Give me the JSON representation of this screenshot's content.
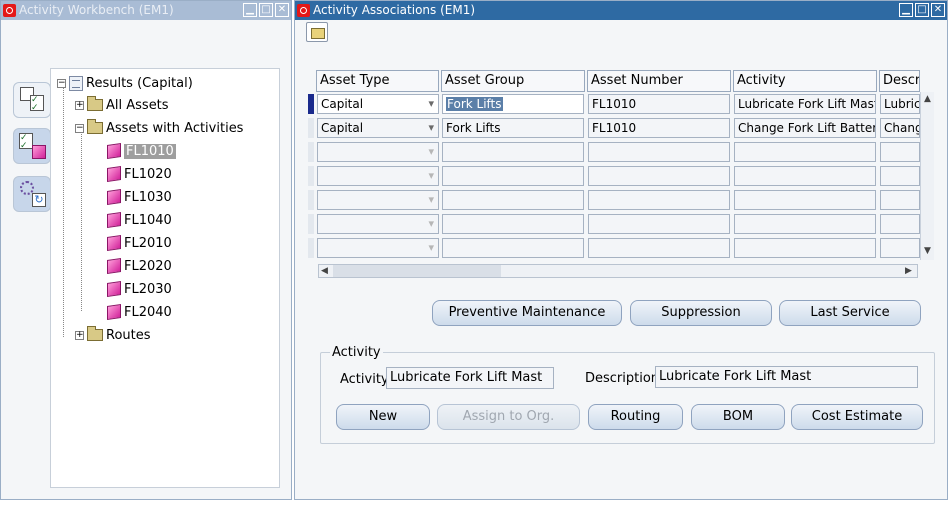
{
  "left_window": {
    "title": "Activity Workbench (EM1)",
    "tree": {
      "root": "Results (Capital)",
      "all_assets": "All Assets",
      "assets_with_activities": "Assets with Activities",
      "assets": [
        "FL1010",
        "FL1020",
        "FL1030",
        "FL1040",
        "FL2010",
        "FL2020",
        "FL2030",
        "FL2040"
      ],
      "routes": "Routes"
    },
    "side_icons": [
      "checklist-icon",
      "activity-icon",
      "refresh-icon"
    ]
  },
  "right_window": {
    "title": "Activity Associations (EM1)",
    "grid": {
      "headers": [
        "Asset Type",
        "Asset Group",
        "Asset Number",
        "Activity",
        "Descri"
      ],
      "rows": [
        {
          "asset_type": "Capital",
          "asset_group": "Fork Lifts",
          "asset_number": "FL1010",
          "activity": "Lubricate Fork Lift Mast",
          "description": "Lubric"
        },
        {
          "asset_type": "Capital",
          "asset_group": "Fork Lifts",
          "asset_number": "FL1010",
          "activity": "Change Fork Lift Battery",
          "description": "Chang"
        }
      ]
    },
    "action_buttons": {
      "preventive_maintenance": "Preventive Maintenance",
      "suppression": "Suppression",
      "last_service": "Last Service"
    },
    "activity_group": {
      "label": "Activity",
      "activity_label": "Activity",
      "activity_value": "Lubricate Fork Lift Mast",
      "description_label": "Description",
      "description_value": "Lubricate Fork Lift Mast"
    },
    "bottom_buttons": {
      "new": "New",
      "assign_to_org": "Assign to Org.",
      "routing": "Routing",
      "bom": "BOM",
      "cost_estimate": "Cost Estimate"
    }
  }
}
